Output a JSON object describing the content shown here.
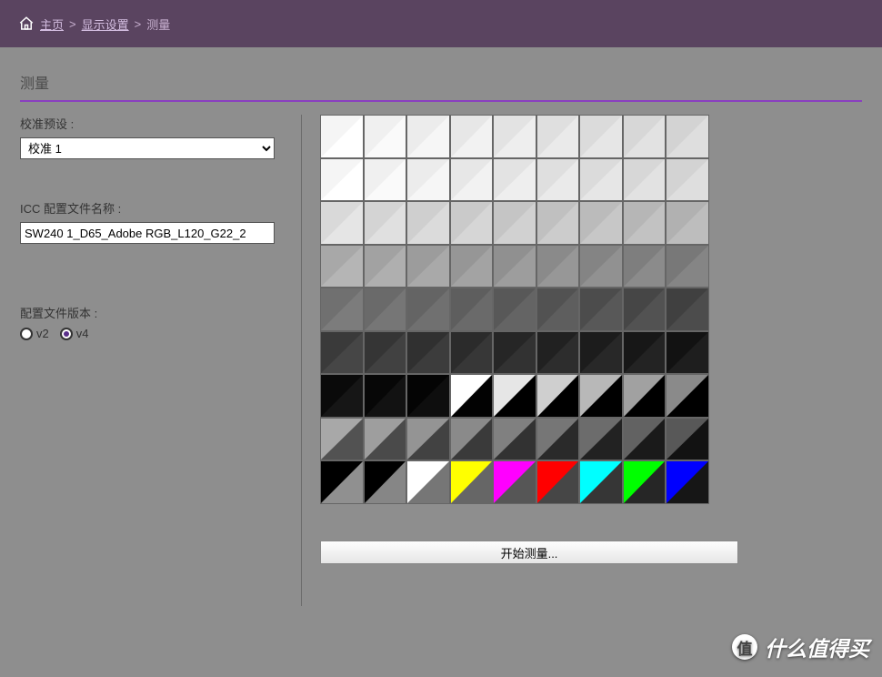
{
  "breadcrumb": {
    "home": "主页",
    "display_settings": "显示设置",
    "current": "测量"
  },
  "page_title": "测量",
  "left": {
    "preset_label": "校准预设 :",
    "preset_value": "校准 1",
    "icc_label": "ICC 配置文件名称 :",
    "icc_value": "SW240 1_D65_Adobe RGB_L120_G22_2",
    "version_label": "配置文件版本 :",
    "v2": "v2",
    "v4": "v4"
  },
  "start_button": "开始测量...",
  "watermark": "什么值得买",
  "grid": {
    "rows": [
      [
        [
          "#f5f5f5",
          "#ffffff"
        ],
        [
          "#f0f0f0",
          "#fafafa"
        ],
        [
          "#ececec",
          "#f6f6f6"
        ],
        [
          "#e7e7e7",
          "#f2f2f2"
        ],
        [
          "#e3e3e3",
          "#eeeeee"
        ],
        [
          "#dfdfdf",
          "#eaeaea"
        ],
        [
          "#dbdbdb",
          "#e6e6e6"
        ],
        [
          "#d7d7d7",
          "#e2e2e2"
        ],
        [
          "#d3d3d3",
          "#dedede"
        ]
      ],
      [
        [
          "#d9d9d9",
          "#e5e5e5"
        ],
        [
          "#d4d4d4",
          "#e0e0e0"
        ],
        [
          "#cfcfcf",
          "#dbdbdb"
        ],
        [
          "#cacaca",
          "#d6d6d6"
        ],
        [
          "#c5c5c5",
          "#d1d1d1"
        ],
        [
          "#c0c0c0",
          "#cccccc"
        ],
        [
          "#bbbbbb",
          "#c7c7c7"
        ],
        [
          "#b6b6b6",
          "#c2c2c2"
        ],
        [
          "#b1b1b1",
          "#bdbdbd"
        ]
      ],
      [
        [
          "#a8a8a8",
          "#b5b5b5"
        ],
        [
          "#a2a2a2",
          "#afafaf"
        ],
        [
          "#9c9c9c",
          "#a9a9a9"
        ],
        [
          "#969696",
          "#a3a3a3"
        ],
        [
          "#909090",
          "#9d9d9d"
        ],
        [
          "#8a8a8a",
          "#979797"
        ],
        [
          "#848484",
          "#919191"
        ],
        [
          "#7e7e7e",
          "#8b8b8b"
        ],
        [
          "#787878",
          "#858585"
        ]
      ],
      [
        [
          "#707070",
          "#7c7c7c"
        ],
        [
          "#6a6a6a",
          "#767676"
        ],
        [
          "#646464",
          "#707070"
        ],
        [
          "#5e5e5e",
          "#6a6a6a"
        ],
        [
          "#585858",
          "#646464"
        ],
        [
          "#525252",
          "#5e5e5e"
        ],
        [
          "#4c4c4c",
          "#585858"
        ],
        [
          "#464646",
          "#525252"
        ],
        [
          "#404040",
          "#4c4c4c"
        ]
      ],
      [
        [
          "#3a3a3a",
          "#464646"
        ],
        [
          "#353535",
          "#414141"
        ],
        [
          "#303030",
          "#3c3c3c"
        ],
        [
          "#2b2b2b",
          "#373737"
        ],
        [
          "#262626",
          "#323232"
        ],
        [
          "#212121",
          "#2d2d2d"
        ],
        [
          "#1c1c1c",
          "#282828"
        ],
        [
          "#171717",
          "#232323"
        ],
        [
          "#121212",
          "#1e1e1e"
        ]
      ],
      [
        [
          "#0a0a0a",
          "#161616"
        ],
        [
          "#070707",
          "#121212"
        ],
        [
          "#040404",
          "#0e0e0e"
        ],
        [
          "#ffffff",
          "#020202"
        ],
        [
          "#e6e6e6",
          "#000000"
        ],
        [
          "#cfcfcf",
          "#000000"
        ],
        [
          "#b8b8b8",
          "#000000"
        ],
        [
          "#a1a1a1",
          "#000000"
        ],
        [
          "#8a8a8a",
          "#000000"
        ]
      ],
      [
        [
          "#a8a8a8",
          "#525252"
        ],
        [
          "#9e9e9e",
          "#4a4a4a"
        ],
        [
          "#949494",
          "#424242"
        ],
        [
          "#8a8a8a",
          "#3a3a3a"
        ],
        [
          "#808080",
          "#323232"
        ],
        [
          "#767676",
          "#2a2a2a"
        ],
        [
          "#6c6c6c",
          "#222222"
        ],
        [
          "#626262",
          "#1a1a1a"
        ],
        [
          "#585858",
          "#121212"
        ]
      ],
      [
        [
          "#000000",
          "#909090"
        ],
        [
          "#000000",
          "#868686"
        ],
        [
          "#ffffff",
          "#767676"
        ],
        [
          "#ffff00",
          "#666666"
        ],
        [
          "#ff00ff",
          "#565656"
        ],
        [
          "#ff0000",
          "#464646"
        ],
        [
          "#00ffff",
          "#363636"
        ],
        [
          "#00ff00",
          "#262626"
        ],
        [
          "#0000ff",
          "#161616"
        ]
      ]
    ]
  }
}
